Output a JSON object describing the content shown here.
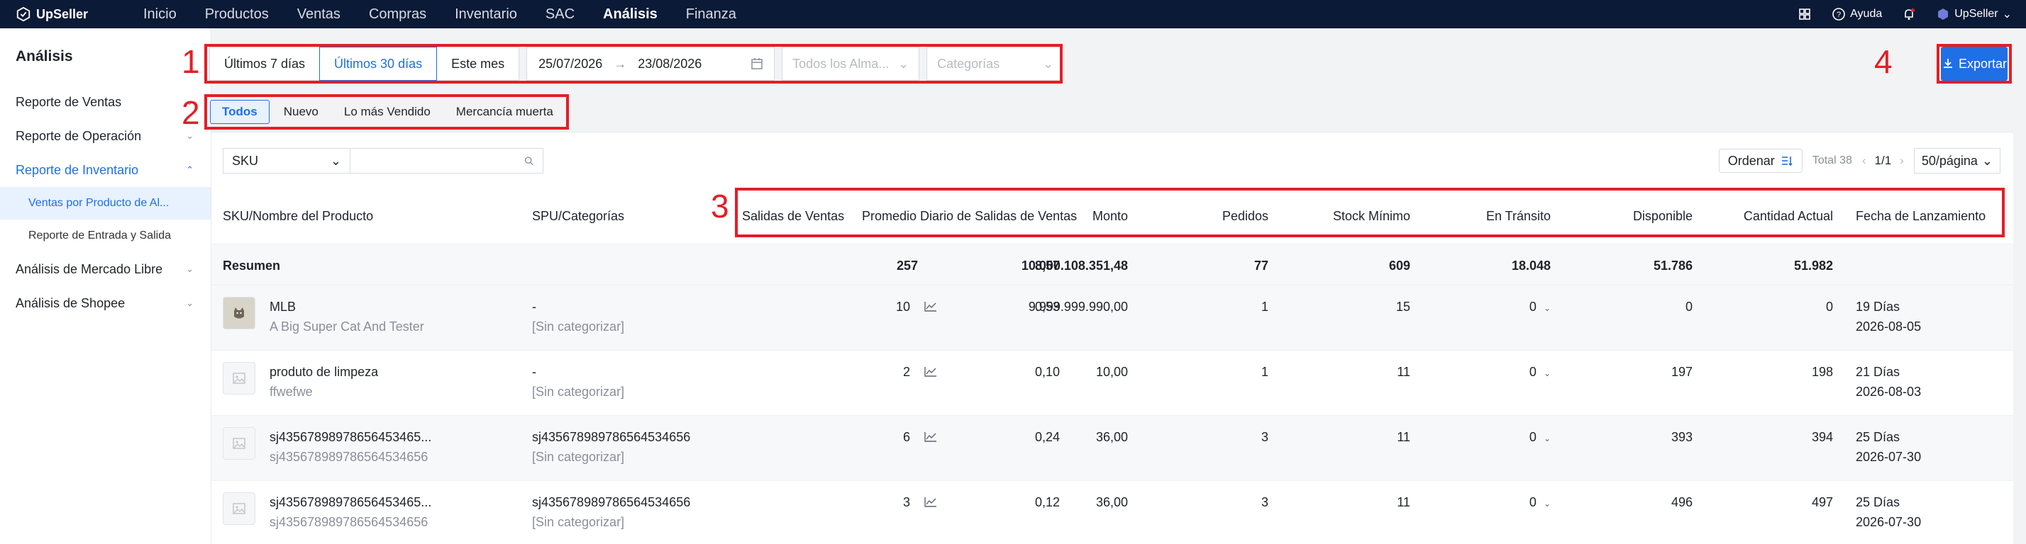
{
  "app": {
    "name": "UpSeller"
  },
  "topnav": {
    "items": [
      "Inicio",
      "Productos",
      "Ventas",
      "Compras",
      "Inventario",
      "SAC",
      "Análisis",
      "Finanza"
    ],
    "active_index": 6,
    "help": "Ayuda",
    "account": "UpSeller"
  },
  "sidebar": {
    "title": "Análisis",
    "items": [
      {
        "label": "Reporte de Ventas"
      },
      {
        "label": "Reporte de Operación"
      },
      {
        "label": "Reporte de Inventario"
      },
      {
        "label": "Análisis de Mercado Libre"
      },
      {
        "label": "Análisis de Shopee"
      }
    ],
    "subitems": [
      "Ventas por Producto de Al...",
      "Reporte de Entrada y Salida"
    ]
  },
  "filters": {
    "quick": [
      "Últimos 7 días",
      "Últimos 30 días",
      "Este mes"
    ],
    "active_quick": 1,
    "date_from": "25/07/2026",
    "date_to": "23/08/2026",
    "warehouse_placeholder": "Todos los Alma...",
    "category_placeholder": "Categorías"
  },
  "export": {
    "label": "Exportar"
  },
  "annotations": [
    "1",
    "2",
    "3",
    "4"
  ],
  "tabs": {
    "items": [
      "Todos",
      "Nuevo",
      "Lo más Vendido",
      "Mercancía muerta"
    ],
    "active_index": 0
  },
  "toolbar": {
    "search_field": "SKU",
    "search_placeholder": "",
    "order_label": "Ordenar",
    "total": "Total 38",
    "page": "1/1",
    "per_page": "50/página"
  },
  "table": {
    "headers": [
      "SKU/Nombre del Producto",
      "SPU/Categorías",
      "Salidas de Ventas",
      "Promedio Diario de Salidas de Ventas",
      "Monto",
      "Pedidos",
      "Stock Mínimo",
      "En Tránsito",
      "Disponible",
      "Cantidad Actual",
      "Fecha de Lanzamiento"
    ],
    "summary": {
      "label": "Resumen",
      "salidas": "257",
      "promedio": "8,57",
      "monto": "10.000.108.351,48",
      "pedidos": "77",
      "stock_min": "609",
      "transito": "18.048",
      "disponible": "51.786",
      "cantidad": "51.982"
    },
    "rows": [
      {
        "name": "MLB",
        "sku": "A Big Super Cat And Tester",
        "spu": "-",
        "cat": "[Sin categorizar]",
        "salidas": "10",
        "promedio": "0,53",
        "monto": "9.999.999.990,00",
        "pedidos": "1",
        "stock_min": "15",
        "transito": "0",
        "disponible": "0",
        "cantidad": "0",
        "dias": "19 Días",
        "fecha": "2026-08-05",
        "image": "cat-photo"
      },
      {
        "name": "produto de limpeza",
        "sku": "ffwefwe",
        "spu": "-",
        "cat": "[Sin categorizar]",
        "salidas": "2",
        "promedio": "0,10",
        "monto": "10,00",
        "pedidos": "1",
        "stock_min": "11",
        "transito": "0",
        "disponible": "197",
        "cantidad": "198",
        "dias": "21 Días",
        "fecha": "2026-08-03",
        "image": "placeholder"
      },
      {
        "name": "sj43567898978656453465...",
        "sku": "sj435678989786564534656",
        "spu": "sj435678989786564534656",
        "cat": "[Sin categorizar]",
        "salidas": "6",
        "promedio": "0,24",
        "monto": "36,00",
        "pedidos": "3",
        "stock_min": "11",
        "transito": "0",
        "disponible": "393",
        "cantidad": "394",
        "dias": "25 Días",
        "fecha": "2026-07-30",
        "image": "placeholder"
      },
      {
        "name": "sj43567898978656453465...",
        "sku": "sj435678989786564534656",
        "spu": "sj435678989786564534656",
        "cat": "[Sin categorizar]",
        "salidas": "3",
        "promedio": "0,12",
        "monto": "36,00",
        "pedidos": "3",
        "stock_min": "11",
        "transito": "0",
        "disponible": "496",
        "cantidad": "497",
        "dias": "25 Días",
        "fecha": "2026-07-30",
        "image": "placeholder"
      }
    ]
  },
  "colors": {
    "nav_bg": "#0b1a36",
    "accent": "#1f6fe5",
    "annotation": "#e41e26"
  }
}
